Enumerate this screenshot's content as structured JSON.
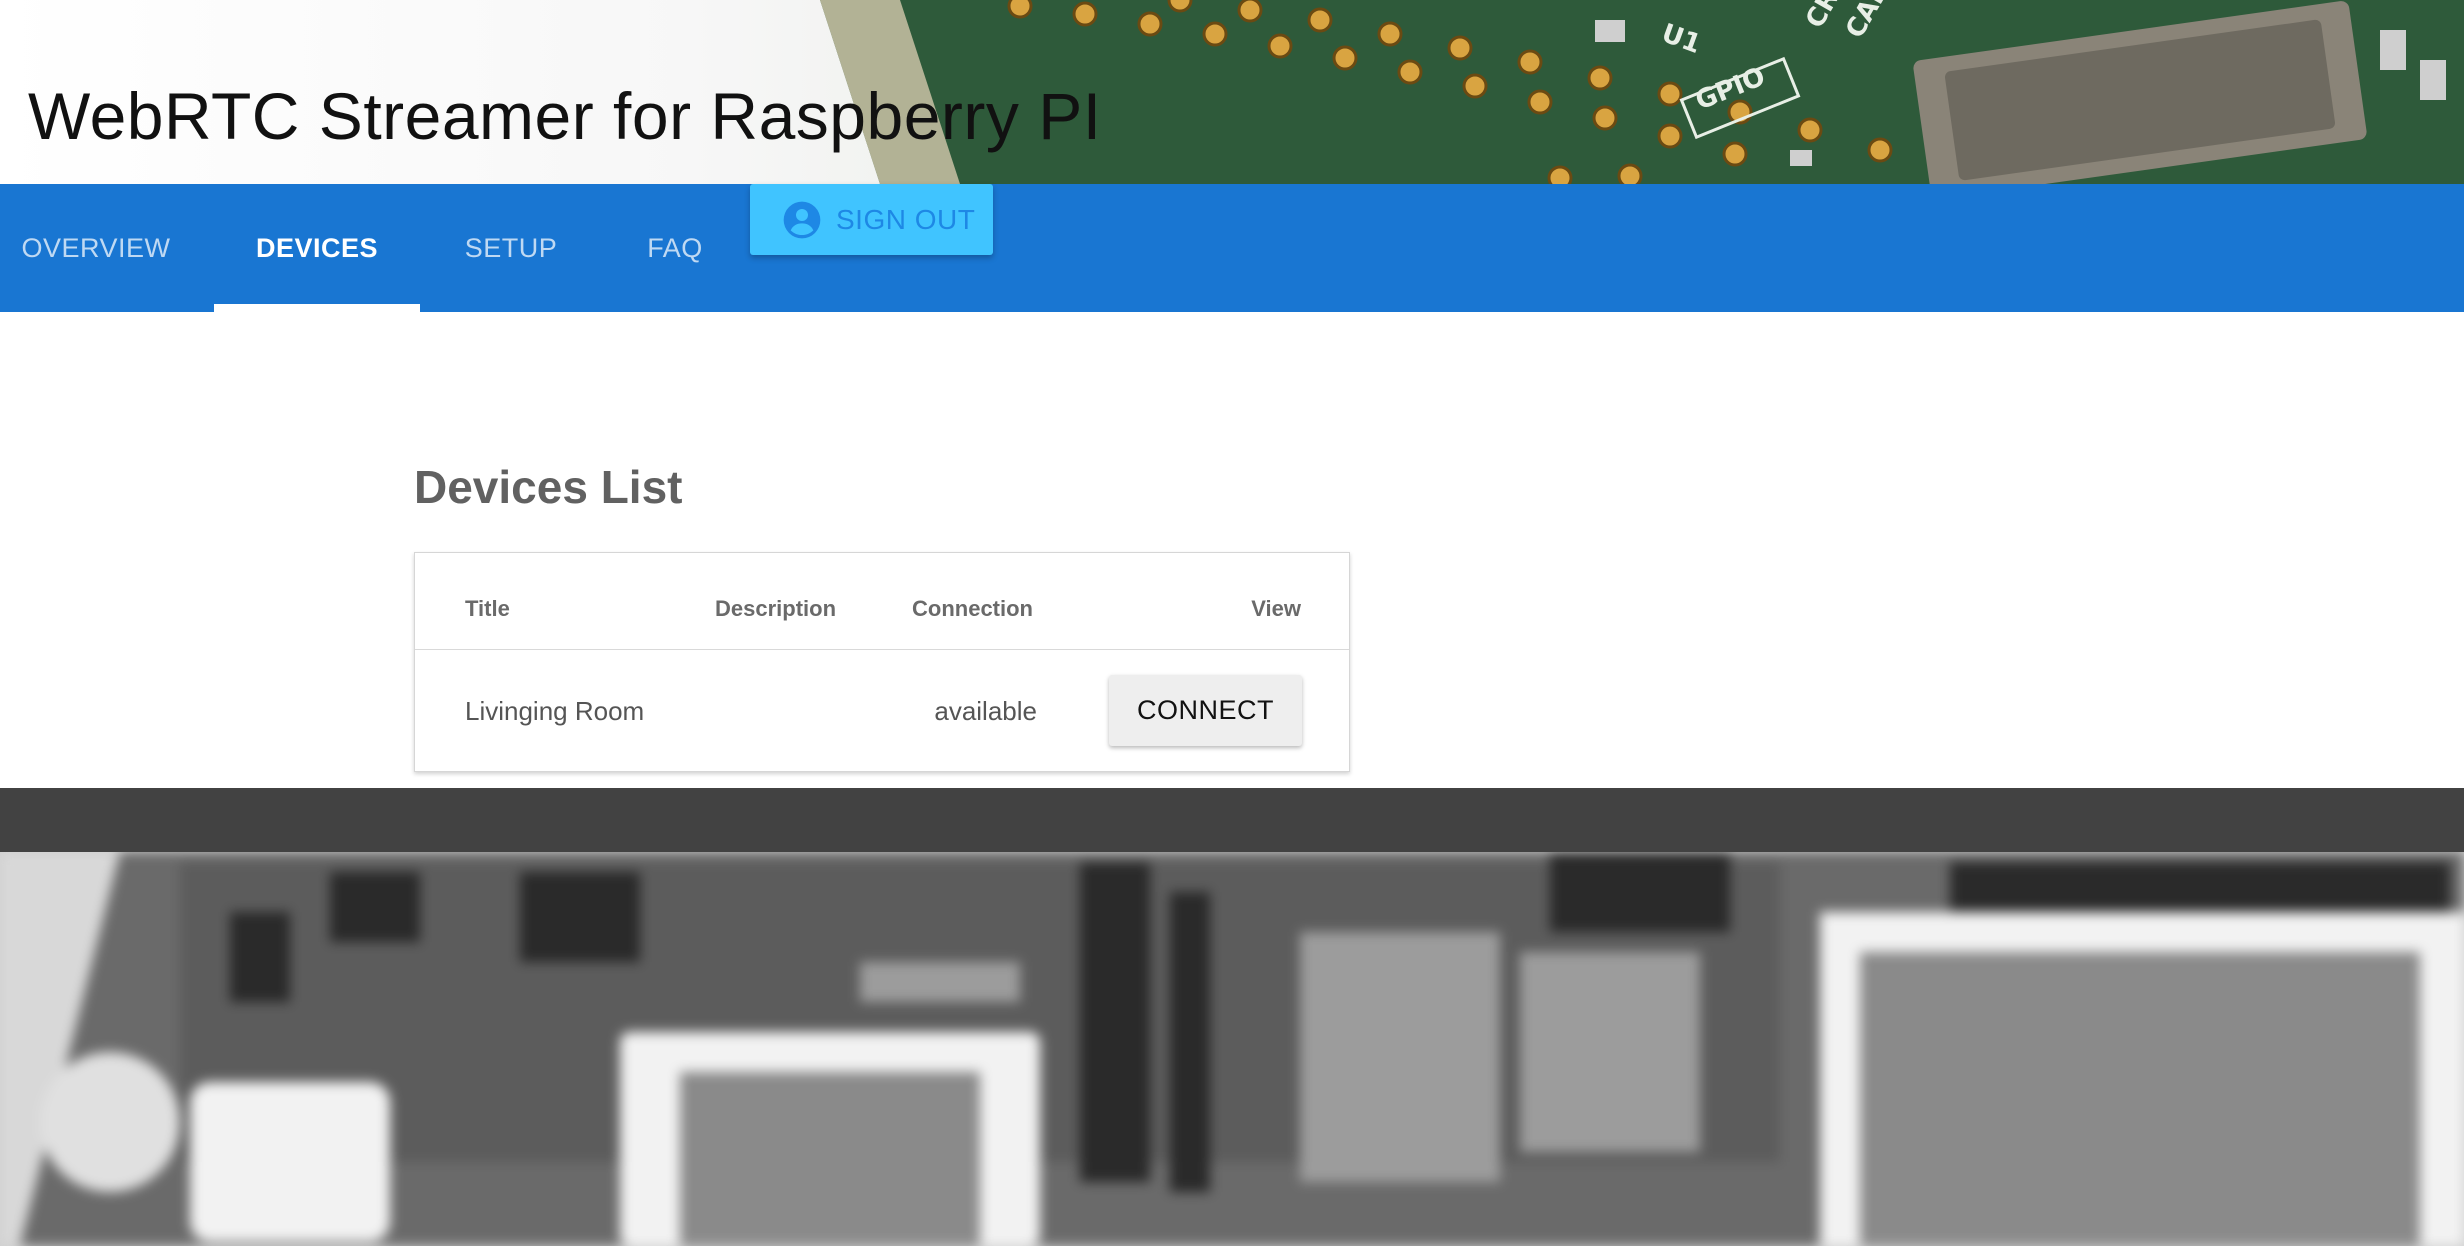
{
  "header": {
    "title": "WebRTC Streamer for Raspberry PI",
    "banner_image": "raspberry-pi-circuit-board"
  },
  "nav": {
    "tabs": [
      {
        "label": "OVERVIEW",
        "active": false
      },
      {
        "label": "DEVICES",
        "active": true
      },
      {
        "label": "SETUP",
        "active": false
      },
      {
        "label": "FAQ",
        "active": false
      }
    ],
    "sign_out": {
      "label": "SIGN OUT",
      "icon": "account-circle-icon"
    }
  },
  "main": {
    "title": "Devices List",
    "table": {
      "columns": [
        "Title",
        "Description",
        "Connection",
        "View"
      ],
      "rows": [
        {
          "title": "Livinging Room",
          "description": "",
          "connection": "available",
          "action_label": "CONNECT"
        }
      ]
    }
  },
  "footer": {
    "background_image": "raspberry-pi-board-blurred-grayscale"
  },
  "colors": {
    "nav_background": "#1976d2",
    "sign_out_background": "#40c4ff",
    "sign_out_text": "#1e88e5",
    "footer_bar": "#424242",
    "connect_button_background": "#eeeeee"
  }
}
